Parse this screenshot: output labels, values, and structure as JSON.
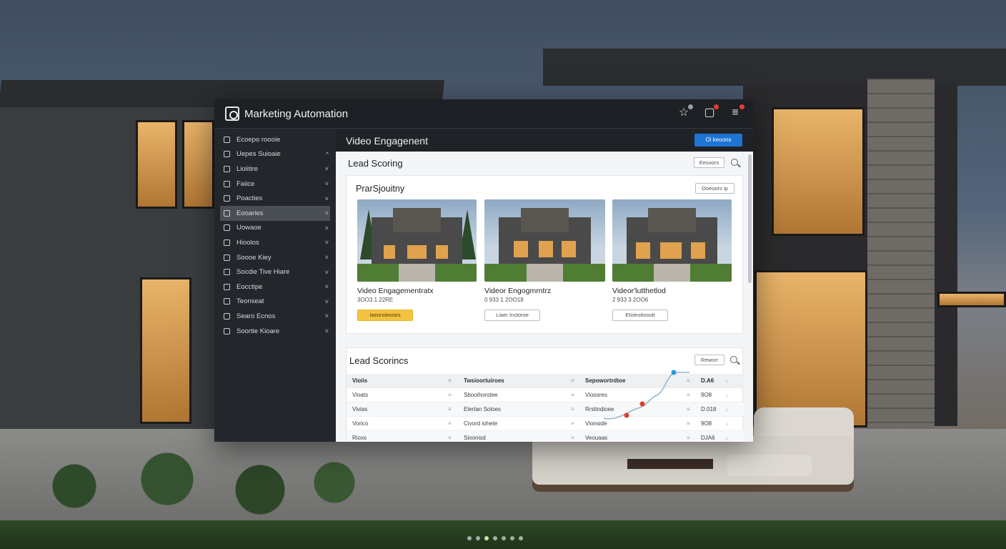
{
  "app": {
    "title": "Marketing Automation"
  },
  "sidebar": {
    "items": [
      {
        "label": "Ecoepo roooie",
        "chevron": ""
      },
      {
        "label": "Uepes Suioaie",
        "chevron": "^"
      },
      {
        "label": "Lioiitire",
        "chevron": "˅"
      },
      {
        "label": "Faiice",
        "chevron": "˅"
      },
      {
        "label": "Poacties",
        "chevron": "˅"
      },
      {
        "label": "Eooaries",
        "chevron": "˅"
      },
      {
        "label": "Uowaoe",
        "chevron": "˅"
      },
      {
        "label": "Hioolos",
        "chevron": "˅"
      },
      {
        "label": "Soooe Kiey",
        "chevron": "˅"
      },
      {
        "label": "Socdie Tive Hiare",
        "chevron": "˅"
      },
      {
        "label": "Eocctipe",
        "chevron": "˅"
      },
      {
        "label": "Teonseat",
        "chevron": "˅"
      },
      {
        "label": "Searo Ecnos",
        "chevron": "˅"
      },
      {
        "label": "Soortie Kioare",
        "chevron": "˅"
      }
    ],
    "active_index": 5
  },
  "main": {
    "title": "Video Engagenent",
    "primary_button": "Oi keoons"
  },
  "lead_scoring": {
    "heading": "Lead Scoring",
    "button": "Eesoors"
  },
  "card": {
    "title": "PrarSjouitny",
    "button": "Ooeoors ip",
    "videos": [
      {
        "title": "Video Engagementratx",
        "sub": "3OO3.1 22RE",
        "button": "Iaeoroieooes",
        "highlight": true
      },
      {
        "title": "Videor Engogmrntrz",
        "sub": "0 933 1 2OO18",
        "button": "Liaer Inctoroe",
        "highlight": false
      },
      {
        "title": "Videor'lutthetlod",
        "sub": "2 933 3 2OO6",
        "button": "Etoieoitoooit",
        "highlight": false
      }
    ]
  },
  "lead_scorings": {
    "heading": "Lead Scorincs",
    "button": "Reworr",
    "columns": [
      "Vioiis",
      "Twsioortuiroes",
      "Sepowortrdtoe",
      "D.A6"
    ],
    "rows": [
      [
        "Vioats",
        "Sbooihorotee",
        "Vioosres",
        "9O8"
      ],
      [
        "Vivias",
        "Elertan Soloes",
        "Rrstindioee",
        "D.018"
      ],
      [
        "Vorico",
        "Civord iohete",
        "Vionside",
        "9O8"
      ],
      [
        "Rioxs",
        "Sioonisd",
        "Veouaas",
        "DJA6"
      ]
    ],
    "sort_icon": "≡",
    "down_icon": "↓"
  },
  "colors": {
    "accent": "#1c74d4",
    "highlight": "#f3c23f",
    "spark_line": "#8fb6c8",
    "spark_red": "#e23b30",
    "spark_blue": "#2b9bd6"
  },
  "icons": [
    "star-icon",
    "notification-icon",
    "menu-icon",
    "search-icon",
    "chevron-icon"
  ]
}
